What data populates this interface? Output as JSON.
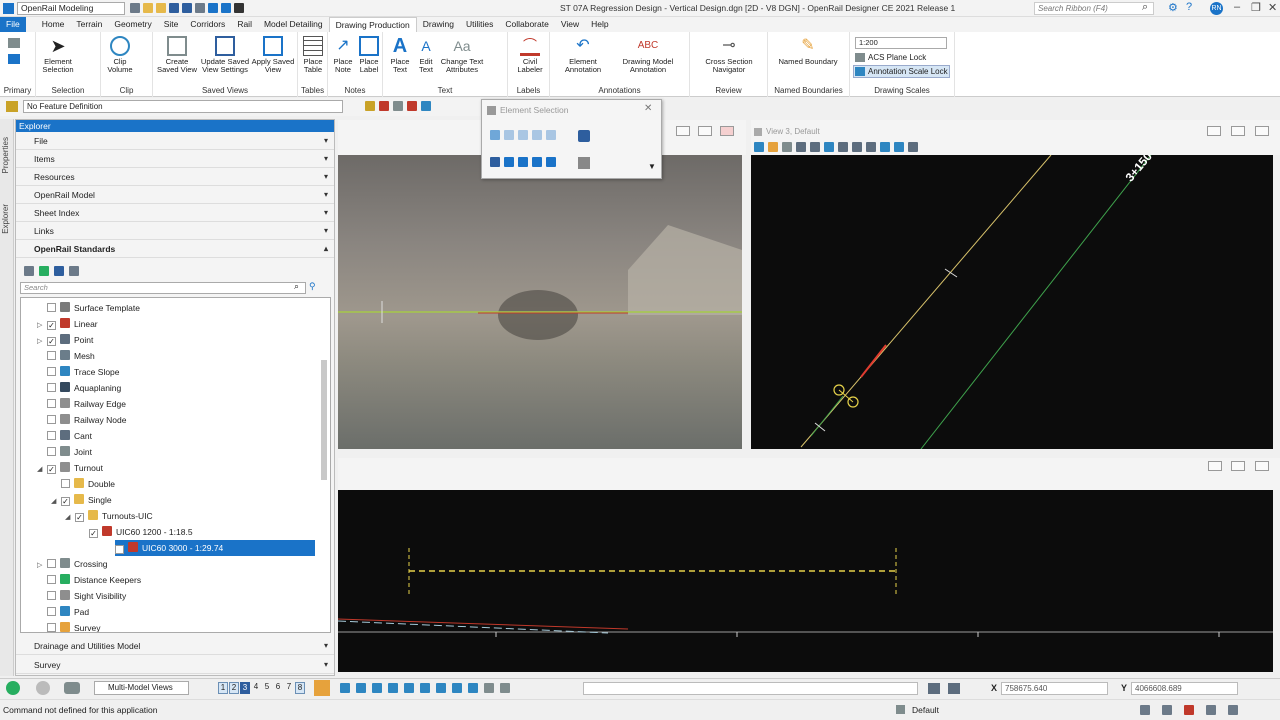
{
  "window": {
    "workflow": "OpenRail Modeling",
    "title": "ST 07A Regression Design - Vertical Design.dgn [2D - V8 DGN] - OpenRail Designer CE 2021 Release 1",
    "search_placeholder": "Search Ribbon (F4)",
    "user": "RN"
  },
  "tabs": [
    "File",
    "Home",
    "Terrain",
    "Geometry",
    "Site",
    "Corridors",
    "Rail",
    "Model Detailing",
    "Drawing Production",
    "Drawing",
    "Utilities",
    "Collaborate",
    "View",
    "Help"
  ],
  "ribbon": {
    "groups": {
      "primary": "Primary",
      "selection": "Selection",
      "clip": "Clip",
      "saved_views": "Saved Views",
      "tables": "Tables",
      "notes": "Notes",
      "text": "Text",
      "labels": "Labels",
      "annotations": "Annotations",
      "review": "Review",
      "named_boundaries": "Named Boundaries",
      "drawing_scales": "Drawing Scales"
    },
    "buttons": {
      "element_selection": "Element Selection",
      "clip_volume": "Clip Volume",
      "create_saved_view": "Create Saved View",
      "update_saved_view": "Update Saved View Settings",
      "apply_saved_view": "Apply Saved View",
      "place_table": "Place Table",
      "place_note": "Place Note",
      "place_label": "Place Label",
      "place_text": "Place Text",
      "edit_text": "Edit Text",
      "change_text": "Change Text Attributes",
      "civil_labeler": "Civil Labeler",
      "element_annotation": "Element Annotation",
      "drawing_model_annotation": "Drawing Model Annotation",
      "cross_section_navigator": "Cross Section Navigator",
      "named_boundary": "Named Boundary"
    },
    "scale_value": "1:200",
    "acs_plane_lock": "ACS Plane Lock",
    "annotation_scale_lock": "Annotation Scale Lock"
  },
  "feature_definition": "No Feature Definition",
  "explorer": {
    "title": "Explorer",
    "sections": [
      "File",
      "Items",
      "Resources",
      "OpenRail Model",
      "Sheet Index",
      "Links",
      "OpenRail Standards"
    ],
    "bottom_sections": [
      "Drainage and Utilities Model",
      "Survey"
    ],
    "search_placeholder": "Search",
    "tree": [
      {
        "label": "Surface Template",
        "indent": 0,
        "arrow": "",
        "checked": false,
        "color": "#7a7a7a"
      },
      {
        "label": "Linear",
        "indent": 0,
        "arrow": "▷",
        "checked": true,
        "color": "#c0392b"
      },
      {
        "label": "Point",
        "indent": 0,
        "arrow": "▷",
        "checked": true,
        "color": "#5d6d7e"
      },
      {
        "label": "Mesh",
        "indent": 0,
        "arrow": "",
        "checked": false,
        "color": "#6b7d8a"
      },
      {
        "label": "Trace Slope",
        "indent": 0,
        "arrow": "",
        "checked": false,
        "color": "#2e86c1"
      },
      {
        "label": "Aquaplaning",
        "indent": 0,
        "arrow": "",
        "checked": false,
        "color": "#34495e"
      },
      {
        "label": "Railway Edge",
        "indent": 0,
        "arrow": "",
        "checked": false,
        "color": "#8e8e8e"
      },
      {
        "label": "Railway Node",
        "indent": 0,
        "arrow": "",
        "checked": false,
        "color": "#8e8e8e"
      },
      {
        "label": "Cant",
        "indent": 0,
        "arrow": "",
        "checked": false,
        "color": "#5d6d7e"
      },
      {
        "label": "Joint",
        "indent": 0,
        "arrow": "",
        "checked": false,
        "color": "#7f8c8d"
      },
      {
        "label": "Turnout",
        "indent": 0,
        "arrow": "◢",
        "checked": true,
        "color": "#8e8e8e"
      },
      {
        "label": "Double",
        "indent": 1,
        "arrow": "",
        "checked": false,
        "color": "#e6b94a"
      },
      {
        "label": "Single",
        "indent": 1,
        "arrow": "◢",
        "checked": true,
        "color": "#e6b94a"
      },
      {
        "label": "Turnouts-UIC",
        "indent": 2,
        "arrow": "◢",
        "checked": true,
        "color": "#e6b94a"
      },
      {
        "label": "UIC60 1200 - 1:18.5",
        "indent": 3,
        "arrow": "",
        "checked": true,
        "color": "#c0392b"
      },
      {
        "label": "UIC60 3000 - 1:29.74",
        "indent": 3,
        "arrow": "",
        "checked": true,
        "color": "#c0392b",
        "selected": true
      },
      {
        "label": "Crossing",
        "indent": 0,
        "arrow": "▷",
        "checked": false,
        "color": "#7f8c8d"
      },
      {
        "label": "Distance Keepers",
        "indent": 0,
        "arrow": "",
        "checked": false,
        "color": "#27ae60"
      },
      {
        "label": "Sight Visibility",
        "indent": 0,
        "arrow": "",
        "checked": false,
        "color": "#8e8e8e"
      },
      {
        "label": "Pad",
        "indent": 0,
        "arrow": "",
        "checked": false,
        "color": "#2e86c1"
      },
      {
        "label": "Survey",
        "indent": 0,
        "arrow": "",
        "checked": false,
        "color": "#e6a23c"
      }
    ]
  },
  "views": {
    "view3_title": "View 3, Default",
    "station_label": "3+150",
    "element_selection_title": "Element Selection"
  },
  "bottom": {
    "view_set": "Multi-Model Views",
    "view_numbers": [
      "1",
      "2",
      "3",
      "4",
      "5",
      "6",
      "7",
      "8"
    ],
    "x_label": "X",
    "x_value": "758675.640",
    "y_label": "Y",
    "y_value": "4066608.689",
    "status_message": "Command not defined for this application",
    "level": "Default"
  }
}
